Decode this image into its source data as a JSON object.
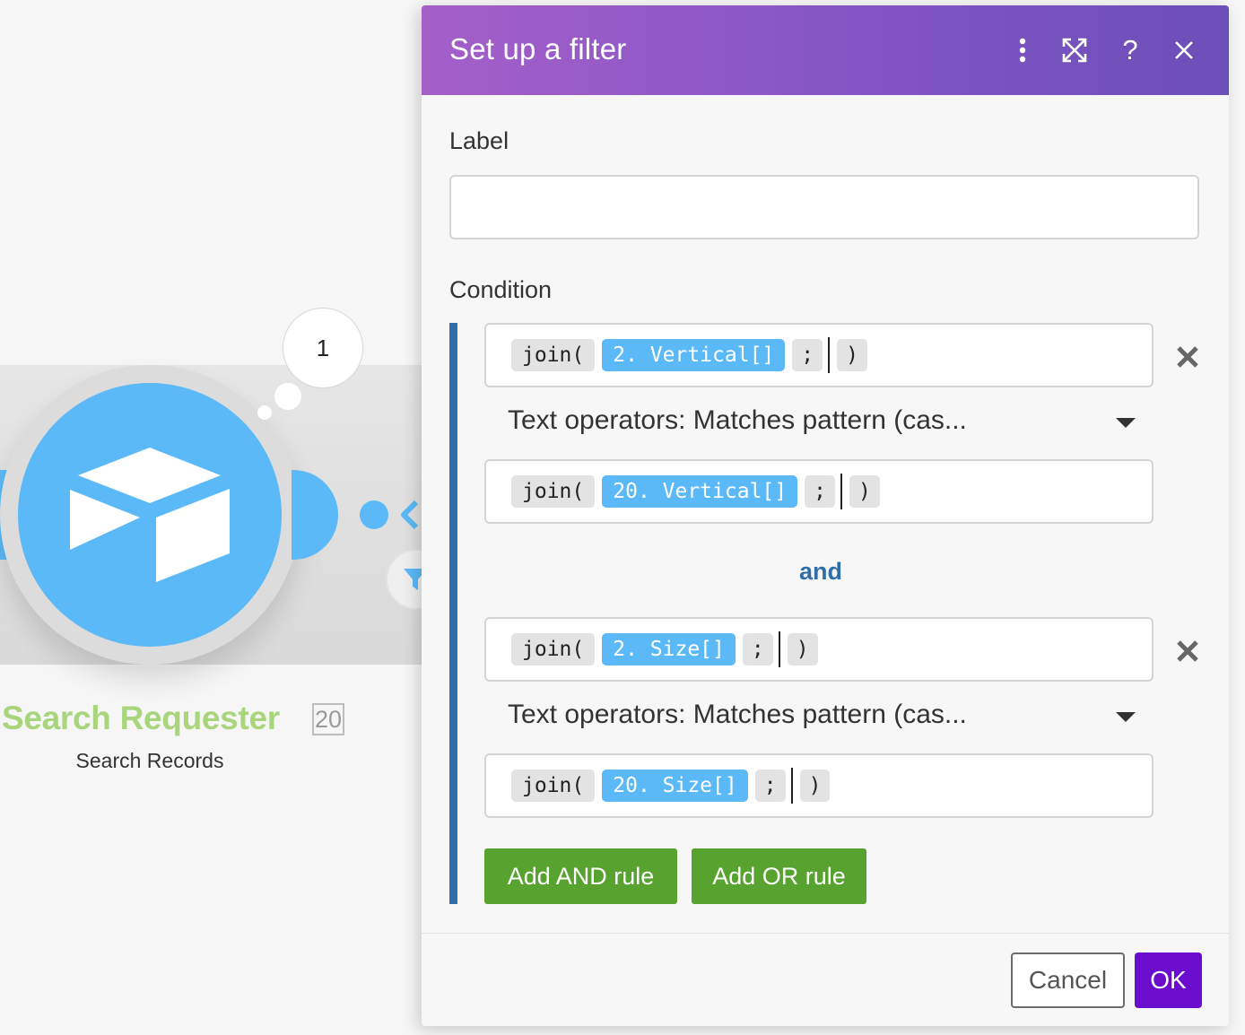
{
  "canvas": {
    "module": {
      "title": "Search Requester",
      "id_badge": "20",
      "subtitle": "Search Records",
      "operations_bubble": "1",
      "icon": "airtable-box-icon",
      "color": "#5bb9f7",
      "title_color": "#a9d57c"
    },
    "route_filter_icon": "filter-icon"
  },
  "dialog": {
    "title": "Set up a filter",
    "header_icons": {
      "more": "more-vertical-icon",
      "fullscreen": "fullscreen-icon",
      "help": "help-icon",
      "close": "close-icon"
    },
    "header_gradient": [
      "#a45fc9",
      "#6b4fb8"
    ],
    "label_field": {
      "label": "Label",
      "value": "",
      "placeholder": ""
    },
    "condition_label": "Condition",
    "rules": [
      {
        "left": {
          "fn": "join(",
          "var": "2. Vertical[]",
          "sep": ";",
          "close": ")"
        },
        "operator": "Text operators: Matches pattern (cas...",
        "right": {
          "fn": "join(",
          "var": "20. Vertical[]",
          "sep": ";",
          "close": ")"
        }
      },
      {
        "left": {
          "fn": "join(",
          "var": "2. Size[]",
          "sep": ";",
          "close": ")"
        },
        "operator": "Text operators: Matches pattern (cas...",
        "right": {
          "fn": "join(",
          "var": "20. Size[]",
          "sep": ";",
          "close": ")"
        }
      }
    ],
    "and_label": "and",
    "buttons": {
      "add_and": "Add AND rule",
      "add_or": "Add OR rule",
      "cancel": "Cancel",
      "ok": "OK"
    },
    "colors": {
      "condition_bar": "#2f6ea8",
      "add_buttons": "#58a22f",
      "ok_button": "#6a0dcc",
      "variable_token": "#5bb9f7"
    }
  }
}
